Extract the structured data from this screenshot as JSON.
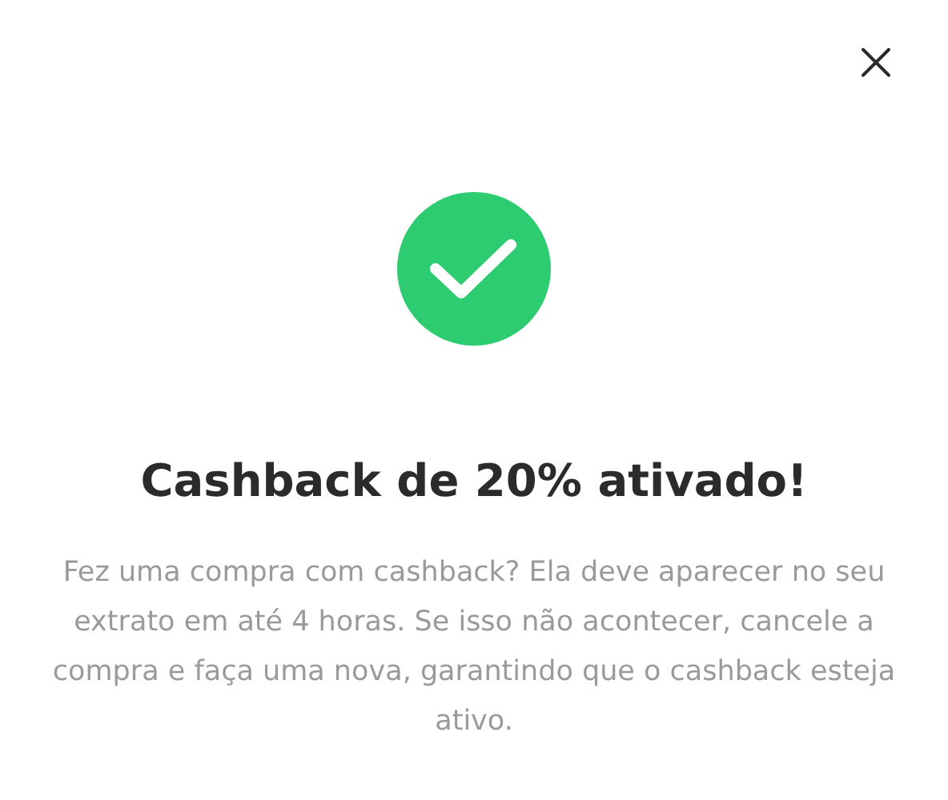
{
  "dialog": {
    "title": "Cashback de 20% ativado!",
    "message": "Fez uma compra com cashback? Ela deve aparecer no seu extrato em até 4 horas. Se isso não acontecer, cancele a compra e faça uma nova, garantindo que o cashback esteja ativo."
  }
}
